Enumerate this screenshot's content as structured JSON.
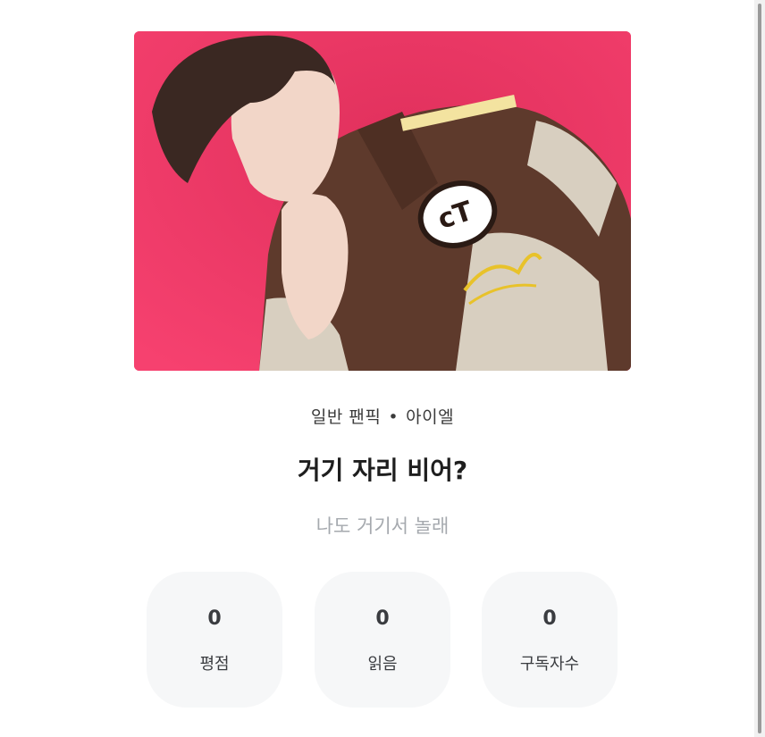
{
  "cover": {
    "alt": "cover image",
    "colors": {
      "background": "#f03a68",
      "jacket": "#5e3a2c",
      "jacket_light": "#d8cfc0"
    }
  },
  "work": {
    "category": "일반 팬픽",
    "separator": "•",
    "tag": "아이엘",
    "title": "거기 자리 비어?",
    "subtitle": "나도 거기서 놀래"
  },
  "stats": [
    {
      "value": "0",
      "label": "평점"
    },
    {
      "value": "0",
      "label": "읽음"
    },
    {
      "value": "0",
      "label": "구독자수"
    }
  ]
}
